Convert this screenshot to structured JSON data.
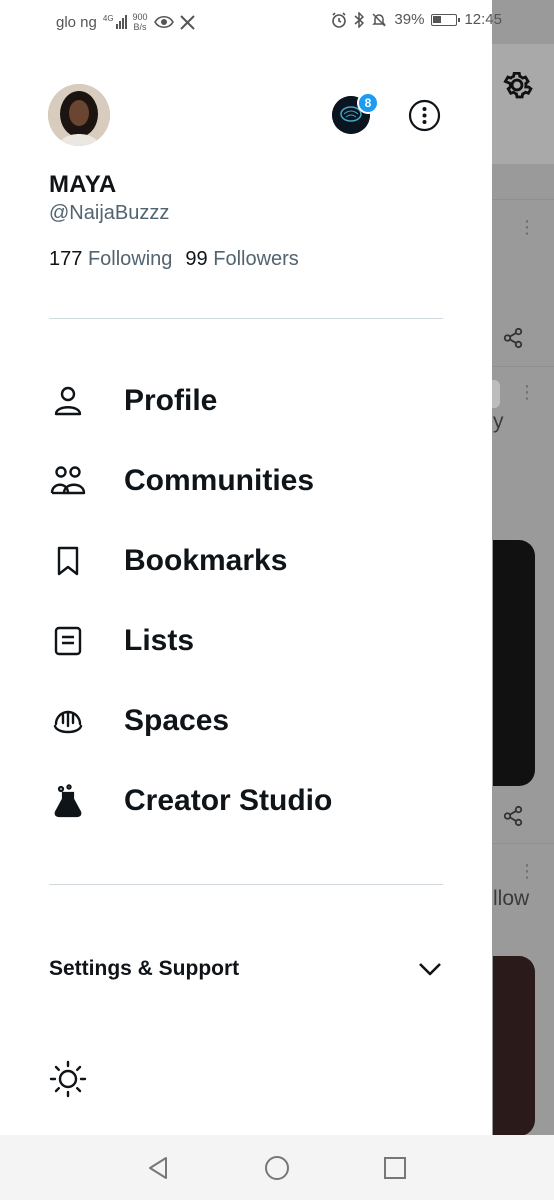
{
  "status_bar": {
    "carrier": "glo ng",
    "network_type": "4G",
    "speed_value": "900",
    "speed_unit": "B/s",
    "battery": "39%",
    "time": "12:45",
    "battery_level": 0.39,
    "icons": [
      "signal-icon",
      "eye-icon",
      "x-logo-icon",
      "alarm-icon",
      "bluetooth-icon",
      "mute-icon",
      "battery-icon"
    ]
  },
  "profile": {
    "name": "MAYA",
    "handle": "@NaijaBuzzz",
    "following_count": "177",
    "following_label": "Following",
    "followers_count": "99",
    "followers_label": "Followers",
    "account_badge_count": "8"
  },
  "menu": [
    {
      "label": "Profile",
      "icon": "person-icon"
    },
    {
      "label": "Communities",
      "icon": "communities-icon"
    },
    {
      "label": "Bookmarks",
      "icon": "bookmark-icon"
    },
    {
      "label": "Lists",
      "icon": "list-icon"
    },
    {
      "label": "Spaces",
      "icon": "spaces-icon"
    },
    {
      "label": "Creator Studio",
      "icon": "creator-studio-icon"
    }
  ],
  "settings": {
    "label": "Settings & Support"
  },
  "backdrop": {
    "partial_text_1": "y",
    "partial_text_2": "llow"
  },
  "colors": {
    "accent": "#1d9bf0",
    "text_primary": "#0f1419",
    "text_secondary": "#536471",
    "divider": "#cfd9de"
  }
}
